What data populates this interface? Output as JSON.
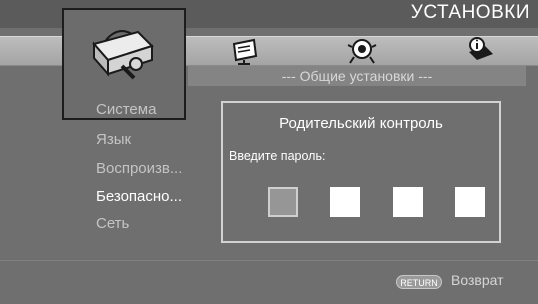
{
  "header": {
    "title": "УСТАНОВКИ"
  },
  "tabs": [
    {
      "icon": "toolbox-icon",
      "selected": true
    },
    {
      "icon": "display-icon",
      "selected": false
    },
    {
      "icon": "speaker-icon",
      "selected": false
    },
    {
      "icon": "info-book-icon",
      "selected": false
    }
  ],
  "section": {
    "title": "--- Общие установки ---"
  },
  "menu": {
    "items": [
      {
        "label": "Система"
      },
      {
        "label": "Язык"
      },
      {
        "label": "Воспроизв..."
      },
      {
        "label": "Безопасно..."
      },
      {
        "label": "Сеть"
      }
    ],
    "active_index": 3
  },
  "dialog": {
    "title": "Родительский контроль",
    "prompt": "Введите пароль:",
    "digits_total": 4,
    "current_digit": 1
  },
  "footer": {
    "return_button": "RETURN",
    "return_label": "Возврат"
  },
  "colors": {
    "background": "#6f6f6f",
    "text": "#ffffff",
    "dim_text": "#c4c4c4"
  }
}
